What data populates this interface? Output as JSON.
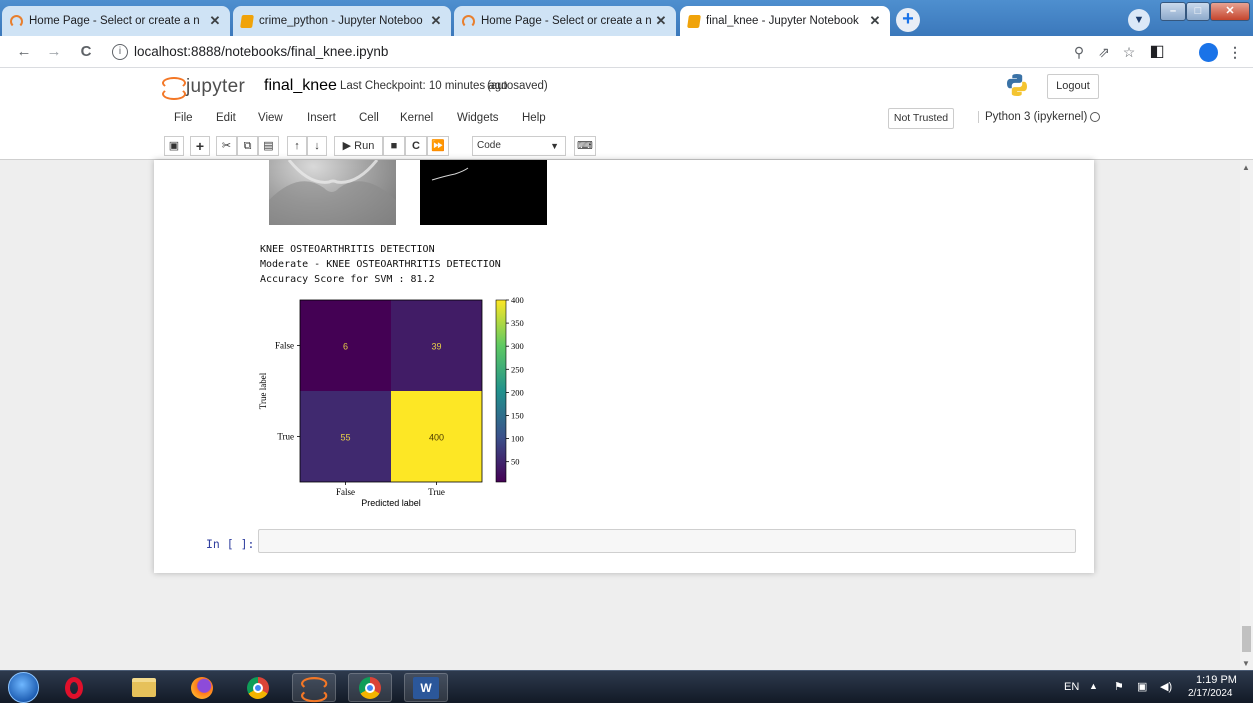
{
  "browser": {
    "tabs": [
      {
        "title": "Home Page - Select or create a n",
        "icon": "jupyter-icon",
        "active": false
      },
      {
        "title": "crime_python - Jupyter Noteboo",
        "icon": "notebook-icon",
        "active": false
      },
      {
        "title": "Home Page - Select or create a n",
        "icon": "jupyter-icon",
        "active": false
      },
      {
        "title": "final_knee - Jupyter Notebook",
        "icon": "notebook-icon",
        "active": true
      }
    ],
    "close_glyph": "✕",
    "new_tab_glyph": "+",
    "url": "localhost:8888/notebooks/final_knee.ipynb"
  },
  "jupyter": {
    "logo_text": "jupyter",
    "notebook_name": "final_knee",
    "checkpoint": "Last Checkpoint: 10 minutes ago",
    "autosave": "(autosaved)",
    "logout_label": "Logout",
    "menu": [
      "File",
      "Edit",
      "View",
      "Insert",
      "Cell",
      "Kernel",
      "Widgets",
      "Help"
    ],
    "trust_label": "Not Trusted",
    "kernel_name": "Python 3 (ipykernel)",
    "toolbar": {
      "run_label": "Run",
      "cell_type": "Code"
    }
  },
  "output": {
    "lines": [
      "KNEE OSTEOARTHRITIS DETECTION",
      "Moderate - KNEE OSTEOARTHRITIS DETECTION",
      "Accuracy Score for SVM : 81.2"
    ]
  },
  "chart_data": {
    "type": "heatmap",
    "title": "",
    "xlabel": "Predicted label",
    "ylabel": "True label",
    "x_categories": [
      "False",
      "True"
    ],
    "y_categories": [
      "False",
      "True"
    ],
    "values": [
      [
        6,
        39
      ],
      [
        55,
        400
      ]
    ],
    "colormap": "viridis",
    "colorbar_ticks": [
      50,
      100,
      150,
      200,
      250,
      300,
      350,
      400
    ],
    "colorbar_range": [
      6,
      400
    ],
    "legend_placement": "right colorbar"
  },
  "input_prompt": "In [ ]:",
  "taskbar": {
    "language": "EN",
    "time": "1:19 PM",
    "date": "2/17/2024"
  }
}
